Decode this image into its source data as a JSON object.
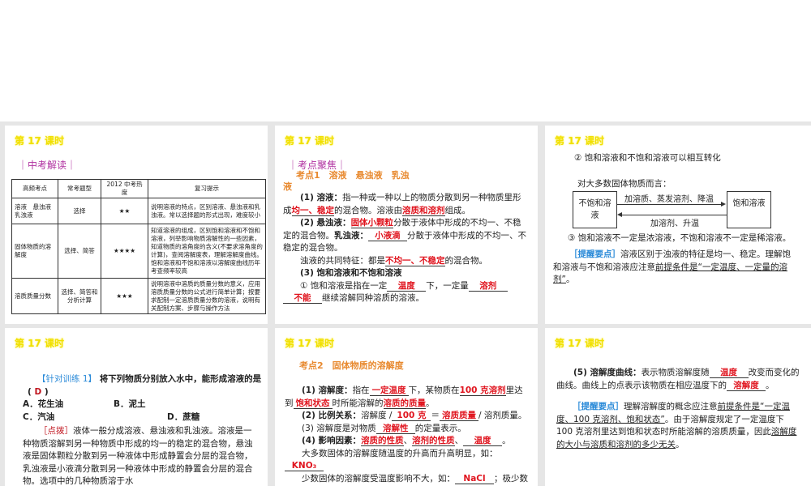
{
  "slide_title": "第 17 课时",
  "s1": {
    "section": "｜中考解读｜",
    "headers": [
      "高频考点",
      "常考题型",
      "2012 中考热度",
      "复习提示"
    ],
    "rows": [
      [
        "溶液　悬浊液乳浊液",
        "选择",
        "★★",
        "说明溶液的特点，区别溶液、悬浊液和乳浊液。常以选择题的形式出现，难度较小"
      ],
      [
        "固体物质的溶解度",
        "选择、简答",
        "★★★★",
        "知道溶液的组成，区别饱和溶液和不饱和溶液，列举影响物质溶解性的一些因素，知道物质的溶角度的含义(不要求溶角度的计算)，查阅溶解度表，理解溶解度曲线。饱和溶液和不饱和溶液以溶解度曲线历年考查频率较高"
      ],
      [
        "溶质质量分数",
        "选择、简答和分析计算",
        "★★★",
        "说明溶液中溶质的质量分数的意义，应用溶质质量分数的公式进行简单计算；按要求配制一定溶质质量分数的溶液，说明有关配制方案、步骤与操作方法"
      ]
    ]
  },
  "s2": {
    "section": "｜考点聚焦｜",
    "kd": "考点1　溶液　悬浊液　乳浊液",
    "paras": [
      [
        {
          "b": "(1) 溶液："
        },
        "指一种或一种以上的物质分散到另一种物质里形成",
        {
          "a": "均一、稳定"
        },
        "的混合物。溶液由",
        {
          "a": "溶质和溶剂"
        },
        "组成。"
      ],
      [
        {
          "b": "(2) 悬浊液："
        },
        {
          "a": "固体小颗粒"
        },
        "分散于液体中形成的不均一、不稳定的混合物。",
        {
          "b": "乳浊液："
        },
        {
          "a": "小液滴"
        },
        "分散于液体中形成的不均一、不稳定的混合物。"
      ],
      [
        "浊液的共同特征：都是",
        {
          "a": "不均一、不稳定"
        },
        "的混合物。"
      ],
      [
        {
          "b": "(3) 饱和溶液和不饱和溶液"
        }
      ],
      [
        "① 饱和溶液是指在一定",
        {
          "a": "温度"
        },
        "下，一定量",
        {
          "a": "溶剂"
        },
        {
          "a": "不能"
        },
        "继续溶解同种溶质的溶液。"
      ]
    ]
  },
  "s3": {
    "p1": "② 饱和溶液和不饱和溶液可以相互转化",
    "p2": "对大多数固体物质而言：",
    "box_left": "不饱和溶　液",
    "box_right": "饱和溶液",
    "arrow_top": "加溶质、蒸发溶剂、降温",
    "arrow_bottom": "加溶剂、升温",
    "p3": "③ 饱和溶液不一定是浓溶液，不饱和溶液不一定是稀溶液。",
    "tip_label": "［提醒要点］",
    "tip_a": "溶液区别于浊液的特征是均一、稳定。理解饱和溶液与不饱和溶液应注意",
    "tip_u": "前提条件是“一定温度、一定量的溶剂”",
    "tip_end": "。"
  },
  "s4": {
    "train_label": "【针对训练 1】",
    "question": "将下列物质分别放入水中，能形成溶液的是(",
    "answer": "D",
    "close": ")",
    "options": [
      "A．花生油",
      "B．泥土",
      "C．汽油",
      "D．蔗糖"
    ],
    "hint_label": "［点拨］",
    "hint": "液体一般分成溶液、悬浊液和乳浊液。溶液是一种物质溶解到另一种物质中形成的均一的稳定的混合物，悬浊液是固体颗粒分散到另一种液体中形成静置会分层的混合物，乳浊液是小液滴分散到另一种液体中形成的静置会分层的混合物。选项中的几种物质溶于水"
  },
  "s5": {
    "kd": "考点2　固体物质的溶解度",
    "paras": [
      [
        {
          "b": "(1) 溶解度："
        },
        "指在",
        {
          "a": "一定温度"
        },
        "下，某物质在",
        {
          "a": "100 克溶剂"
        },
        "里达到",
        {
          "a": "饱和状态"
        },
        "时所能溶解的",
        {
          "a": "溶质的质量"
        },
        "。"
      ],
      [
        {
          "b": "(2) 比例关系："
        },
        "溶解度 /",
        {
          "a": "100 克"
        },
        "＝",
        {
          "a": "溶质质量"
        },
        "/ 溶剂质量。"
      ],
      [
        "(3) 溶解度是对物质",
        {
          "a": "溶解性"
        },
        "的定量表示。"
      ],
      [
        {
          "b": "(4) 影响因素："
        },
        {
          "a": "溶质的性质"
        },
        "、",
        {
          "a": "溶剂的性质"
        },
        "、",
        {
          "a": "温度"
        },
        "。"
      ],
      [
        "大多数固体的溶解度随温度的升高而升高明显，如：",
        {
          "a": "KNO₃"
        }
      ],
      [
        "少数固体的溶解度受温度影响不大，如：",
        {
          "a": "NaCl"
        },
        "；极少数"
      ]
    ]
  },
  "s6": {
    "paras": [
      [
        {
          "b": "(5) 溶解度曲线："
        },
        "表示物质溶解度随",
        {
          "a": "温度"
        },
        "改变而变化的曲线。曲线上的点表示该物质在相应温度下的",
        {
          "a": "溶解度"
        },
        "。"
      ]
    ],
    "tip_label": "［提醒要点］",
    "tip_a": "理解溶解度的概念应注意",
    "tip_u": "前提条件是“一定温度、100 克溶剂、饱和状态”",
    "tip_b": "。由于溶解度规定了一定温度下 100 克溶剂里达到饱和状态时所能溶解的溶质质量，因此",
    "tip_u2": "溶解度的大小与溶质和溶剂的多少无关",
    "tip_end": "。"
  }
}
